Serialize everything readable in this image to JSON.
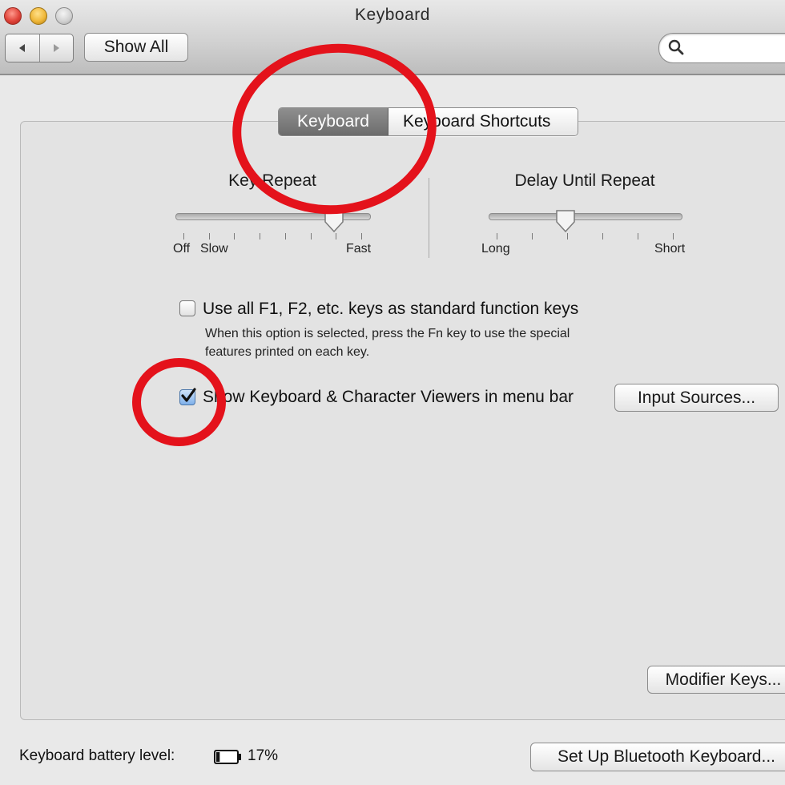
{
  "window": {
    "title": "Keyboard"
  },
  "toolbar": {
    "back_icon": "chevron-left-icon",
    "forward_icon": "chevron-right-icon",
    "show_all_label": "Show All",
    "search_icon": "search-icon",
    "search_value": ""
  },
  "tabs": [
    {
      "label": "Keyboard",
      "selected": true
    },
    {
      "label": "Keyboard Shortcuts",
      "selected": false
    }
  ],
  "key_repeat": {
    "title": "Key Repeat",
    "labels": {
      "off": "Off",
      "slow": "Slow",
      "fast": "Fast"
    },
    "level": 0.82
  },
  "delay_until_repeat": {
    "title": "Delay Until Repeat",
    "labels": {
      "long": "Long",
      "short": "Short"
    },
    "level": 0.4
  },
  "function_keys": {
    "label": "Use all F1, F2, etc. keys as standard function keys",
    "description_line1": "When this option is selected, press the Fn key to use the special",
    "description_line2": "features printed on each key.",
    "checked": false
  },
  "viewers": {
    "label": "Show Keyboard & Character Viewers in menu bar",
    "checked": true
  },
  "buttons": {
    "input_sources": "Input Sources...",
    "modifier_keys": "Modifier Keys...",
    "bluetooth_setup": "Set Up Bluetooth Keyboard..."
  },
  "battery": {
    "label": "Keyboard battery level:",
    "icon": "battery-icon",
    "level_text": "17%",
    "level": 0.17
  },
  "colors": {
    "annotation_red": "#e4121b",
    "selected_tab": "#7a7a7a",
    "checkbox_blue": "#7fb0ea"
  }
}
